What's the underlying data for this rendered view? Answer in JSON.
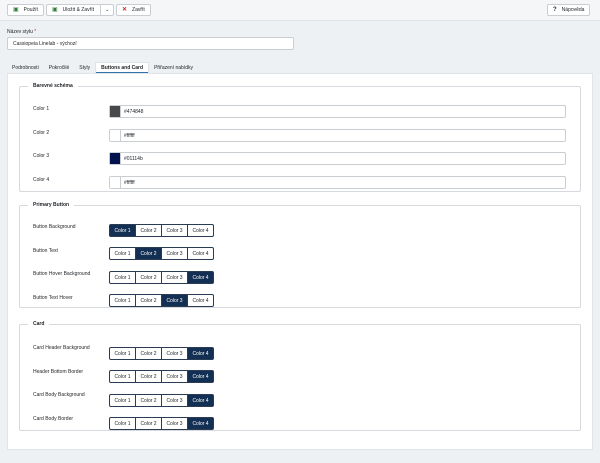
{
  "toolbar": {
    "apply": "Použít",
    "save_close": "Uložit & Zavřít",
    "close": "Zavřít",
    "help": "Nápověda"
  },
  "style_name": {
    "label": "Název stylu",
    "required_mark": "*",
    "value": "Cassiopeia Linelab - výchozí"
  },
  "tabs": [
    "Podrobnosti",
    "Pokročilé",
    "Styly",
    "Buttons and Card",
    "Přiřazení nabídky"
  ],
  "active_tab": "Buttons and Card",
  "color_scheme": {
    "legend": "Barevné schéma",
    "colors": [
      {
        "label": "Color 1",
        "hex": "#474848",
        "swatch": "#474848"
      },
      {
        "label": "Color 2",
        "hex": "#ffffff",
        "swatch": "#ffffff"
      },
      {
        "label": "Color 3",
        "hex": "#01114b",
        "swatch": "#01114b"
      },
      {
        "label": "Color 4",
        "hex": "#ffffff",
        "swatch": "#ffffff"
      }
    ]
  },
  "options": [
    "Color 1",
    "Color 2",
    "Color 3",
    "Color 4"
  ],
  "primary_button": {
    "legend": "Primary Button",
    "rows": [
      {
        "label": "Button Background",
        "selected": "Color 1"
      },
      {
        "label": "Button Text",
        "selected": "Color 2"
      },
      {
        "label": "Button Hover Background",
        "selected": "Color 4"
      },
      {
        "label": "Button Text Hover",
        "selected": "Color 3"
      }
    ]
  },
  "card": {
    "legend": "Card",
    "rows": [
      {
        "label": "Card Header Background",
        "selected": "Color 4"
      },
      {
        "label": "Header Bottom Border",
        "selected": "Color 4"
      },
      {
        "label": "Card Body Background",
        "selected": "Color 4"
      },
      {
        "label": "Card Body Border",
        "selected": "Color 4"
      }
    ]
  }
}
